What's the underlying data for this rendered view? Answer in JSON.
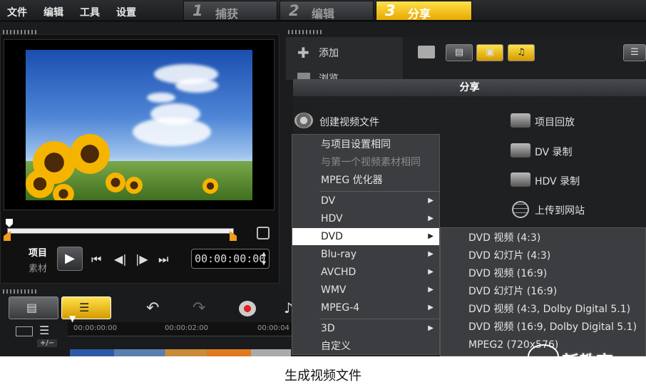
{
  "menu": {
    "file": "文件",
    "edit": "编辑",
    "tools": "工具",
    "settings": "设置"
  },
  "steps": [
    {
      "num": "1",
      "label": "捕获"
    },
    {
      "num": "2",
      "label": "编辑"
    },
    {
      "num": "3",
      "label": "分享"
    }
  ],
  "player": {
    "project_label": "项目",
    "clip_label": "素材",
    "timecode": "00:00:00:00"
  },
  "library": {
    "add_label": "添加",
    "browse_label": "浏览"
  },
  "share": {
    "title": "分享",
    "create_video": "创建视频文件",
    "project_playback": "项目回放",
    "dv_record": "DV 录制",
    "hdv_record": "HDV 录制",
    "upload_web": "上传到网站"
  },
  "context_menu": {
    "items": [
      {
        "label": "与项目设置相同",
        "disabled": false,
        "arrow": false
      },
      {
        "label": "与第一个视频素材相同",
        "disabled": true,
        "arrow": false
      },
      {
        "label": "MPEG 优化器",
        "disabled": false,
        "arrow": false
      },
      {
        "label": "DV",
        "disabled": false,
        "arrow": true
      },
      {
        "label": "HDV",
        "disabled": false,
        "arrow": true
      },
      {
        "label": "DVD",
        "disabled": false,
        "arrow": true
      },
      {
        "label": "Blu-ray",
        "disabled": false,
        "arrow": true
      },
      {
        "label": "AVCHD",
        "disabled": false,
        "arrow": true
      },
      {
        "label": "WMV",
        "disabled": false,
        "arrow": true
      },
      {
        "label": "MPEG-4",
        "disabled": false,
        "arrow": true
      },
      {
        "label": "3D",
        "disabled": false,
        "arrow": true
      },
      {
        "label": "自定义",
        "disabled": false,
        "arrow": false
      }
    ],
    "arrow_glyph": "▶"
  },
  "dvd_submenu": {
    "items": [
      "DVD 视频 (4:3)",
      "DVD 幻灯片 (4:3)",
      "DVD 视频 (16:9)",
      "DVD 幻灯片 (16:9)",
      "DVD 视频 (4:3, Dolby Digital 5.1)",
      "DVD 视频 (16:9, Dolby Digital 5.1)",
      "MPEG2 (720x576)"
    ]
  },
  "timeline": {
    "ruler": [
      "00:00:00:00",
      "00:00:02:00",
      "00:00:04"
    ],
    "zoom": "+/−"
  },
  "caption": "生成视频文件",
  "watermark": "新教育",
  "colors": {
    "accent": "#f0b400",
    "highlight": "#ffffff",
    "menu_bg": "#3c3d40"
  }
}
